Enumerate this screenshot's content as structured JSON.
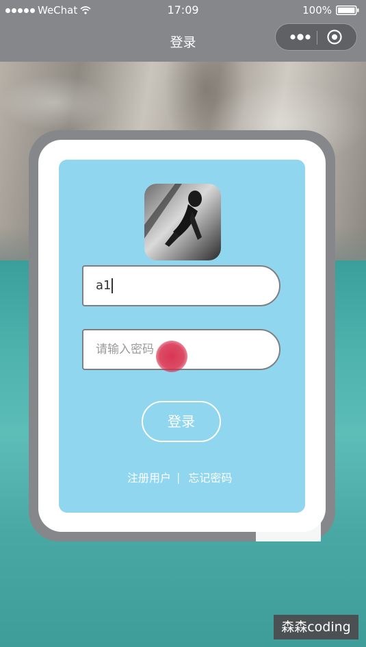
{
  "status_bar": {
    "carrier": "WeChat",
    "time": "17:09",
    "battery": "100%"
  },
  "nav": {
    "title": "登录",
    "more_icon": "more-dots-icon",
    "close_icon": "target-circle-icon"
  },
  "login_form": {
    "username_value": "a1",
    "password_placeholder": "请输入密码",
    "submit_label": "登录",
    "register_link": "注册用户",
    "separator": "|",
    "forgot_link": "忘记密码"
  },
  "watermark": {
    "text": "森森coding"
  },
  "colors": {
    "panel": "#8fd6ee",
    "frame": "#85878a",
    "tap_dot": "#d62c4a"
  }
}
